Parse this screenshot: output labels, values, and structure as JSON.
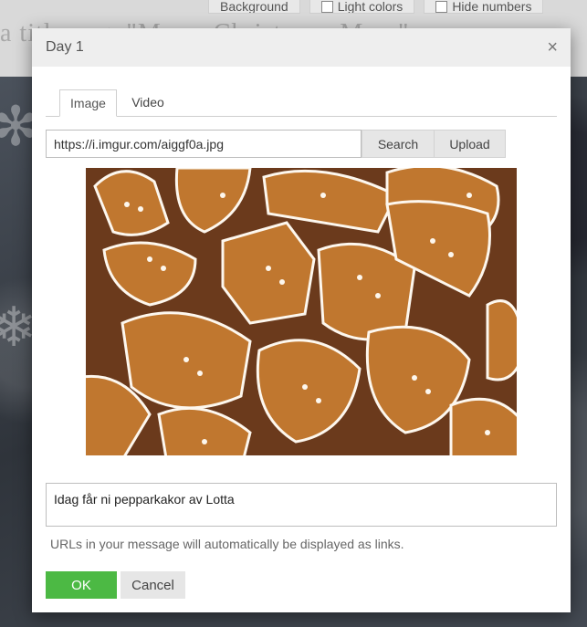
{
  "background": {
    "toolbar": {
      "background_label": "Background",
      "light_colors_label": "Light colors",
      "hide_numbers_label": "Hide numbers"
    },
    "title_text": "a title, e.g. \"Merry Christmas, Mum\""
  },
  "dialog": {
    "title": "Day 1",
    "close_symbol": "×",
    "tabs": [
      {
        "label": "Image",
        "active": true
      },
      {
        "label": "Video",
        "active": false
      }
    ],
    "url_value": "https://i.imgur.com/aiggf0a.jpg",
    "search_label": "Search",
    "upload_label": "Upload",
    "message_value": "Idag får ni pepparkakor av Lotta",
    "hint": "URLs in your message will automatically be displayed as links.",
    "ok_label": "OK",
    "cancel_label": "Cancel"
  },
  "colors": {
    "ok_green": "#4cb944",
    "header_gray": "#eeeeee",
    "cookie_brown": "#b8702e",
    "icing_white": "#fdf7ee"
  }
}
